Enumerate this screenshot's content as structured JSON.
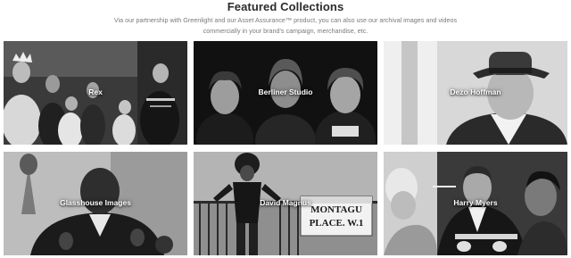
{
  "section": {
    "title": "Featured Collections",
    "intro": "Via our partnership with Greenlight and our Asset Assurance™ product, you can also use our archival images and videos commercially in your brand's campaign, merchandise, etc."
  },
  "collections": [
    {
      "label": "Rex"
    },
    {
      "label": "Berliner Studio"
    },
    {
      "label": "Dezo Hoffman"
    },
    {
      "label": "Glasshouse Images"
    },
    {
      "label": "David Magnus"
    },
    {
      "label": "Harry Myers",
      "sign_text": "MONTAGU PLACE. W.1"
    }
  ],
  "sign": {
    "line1": "MONTAGU",
    "line2": "PLACE. W.1"
  }
}
